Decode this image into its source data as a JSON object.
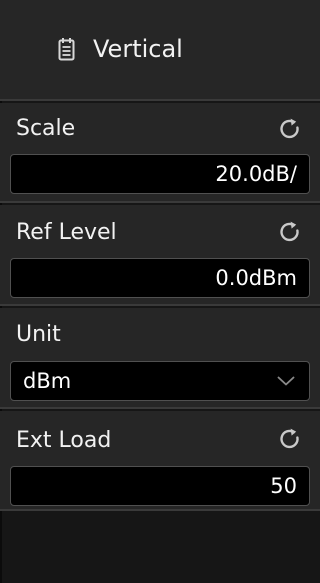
{
  "header": {
    "title": "Vertical",
    "icon": "document-list-icon"
  },
  "sections": [
    {
      "label": "Scale",
      "value": "20.0dB/",
      "reset_icon": "reset-icon"
    },
    {
      "label": "Ref Level",
      "value": "0.0dBm",
      "reset_icon": "reset-icon"
    },
    {
      "label": "Unit",
      "value": "dBm",
      "dropdown_icon": "chevron-down-icon"
    },
    {
      "label": "Ext Load",
      "value": "50",
      "reset_icon": "reset-icon"
    }
  ],
  "colors": {
    "panel_bg": "#262626",
    "field_bg": "#000000",
    "text": "#f2f2f2",
    "divider": "#3a3a3a"
  }
}
